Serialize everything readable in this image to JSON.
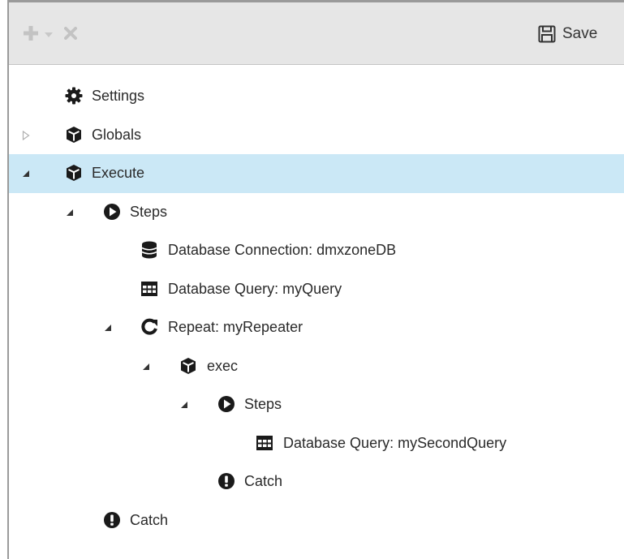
{
  "toolbar": {
    "add_icon": "plus-icon",
    "dropdown_icon": "caret-down-icon",
    "delete_icon": "close-icon",
    "save_label": "Save",
    "save_icon": "floppy-disk-icon"
  },
  "tree": {
    "settings": {
      "label": "Settings",
      "icon": "gear-icon"
    },
    "globals": {
      "label": "Globals",
      "icon": "cube-icon",
      "expanded": false
    },
    "execute": {
      "label": "Execute",
      "icon": "cube-icon",
      "expanded": true,
      "selected": true
    },
    "steps": {
      "label": "Steps",
      "icon": "play-circle-icon",
      "expanded": true
    },
    "db_connection": {
      "label": "Database Connection: dmxzoneDB",
      "icon": "database-icon"
    },
    "db_query": {
      "label": "Database Query: myQuery",
      "icon": "table-icon"
    },
    "repeat": {
      "label": "Repeat: myRepeater",
      "icon": "repeat-icon",
      "expanded": true
    },
    "exec": {
      "label": "exec",
      "icon": "cube-icon",
      "expanded": true
    },
    "inner_steps": {
      "label": "Steps",
      "icon": "play-circle-icon",
      "expanded": true
    },
    "db_query2": {
      "label": "Database Query: mySecondQuery",
      "icon": "table-icon"
    },
    "inner_catch": {
      "label": "Catch",
      "icon": "exclamation-circle-icon"
    },
    "catch": {
      "label": "Catch",
      "icon": "exclamation-circle-icon"
    }
  },
  "colors": {
    "selected_row": "#cbe8f6",
    "toolbar_bg": "#e6e6e6",
    "disabled_icon": "#c3c3c3",
    "icon": "#1a1a1a"
  }
}
